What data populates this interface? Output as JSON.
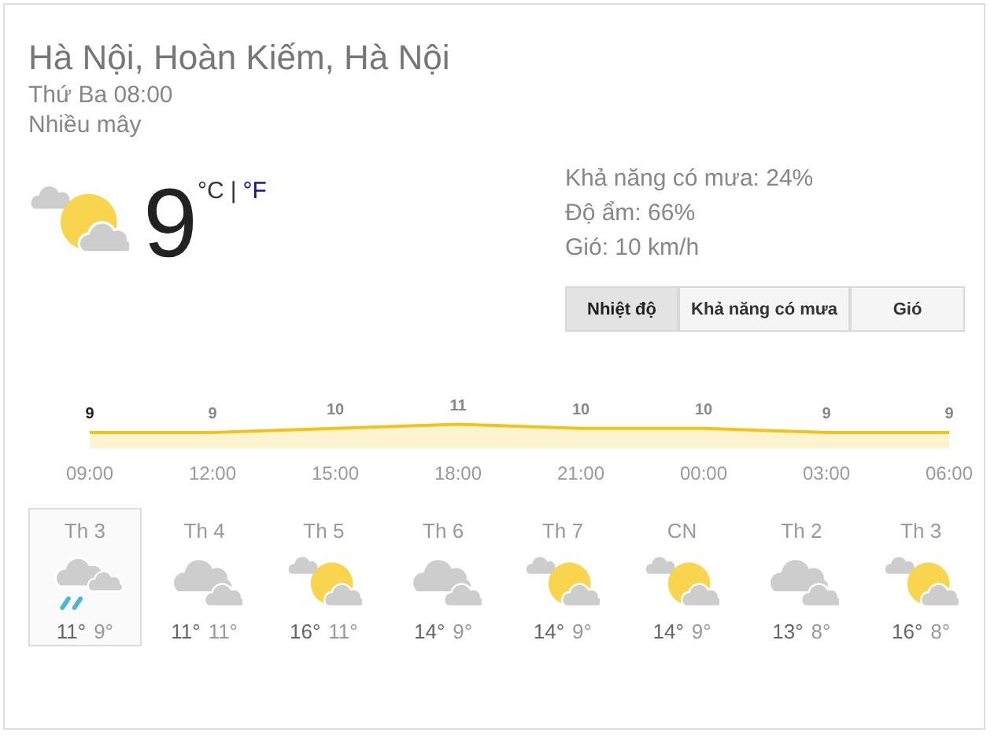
{
  "location": "Hà Nội, Hoàn Kiếm, Hà Nội",
  "time": "Thứ Ba 08:00",
  "condition": "Nhiều mây",
  "current": {
    "kind": "partly-cloudy",
    "temperature": "9",
    "units": [
      {
        "label": "°C",
        "selected": true
      },
      {
        "label": "°F",
        "selected": false
      }
    ],
    "separator": "|"
  },
  "details": [
    "Khả năng có mưa: 24%",
    "Độ ẩm: 66%",
    "Gió: 10 km/h"
  ],
  "tabs": [
    {
      "label": "Nhiệt độ",
      "selected": true
    },
    {
      "label": "Khả năng có mưa",
      "selected": false
    },
    {
      "label": "Gió",
      "selected": false
    }
  ],
  "chart_data": {
    "type": "area",
    "categories": [
      "09:00",
      "12:00",
      "15:00",
      "18:00",
      "21:00",
      "00:00",
      "03:00",
      "06:00"
    ],
    "series": [
      {
        "color": "#f2c418",
        "values": [
          9,
          9,
          10,
          11,
          10,
          10,
          9,
          9
        ]
      }
    ],
    "data_labels": true
  },
  "days": [
    {
      "day": "Th 3",
      "kind": "rain",
      "high": "11°",
      "low": "9°",
      "selected": true
    },
    {
      "day": "Th 4",
      "kind": "cloudy",
      "high": "11°",
      "low": "11°",
      "selected": false
    },
    {
      "day": "Th 5",
      "kind": "partly-cloudy",
      "high": "16°",
      "low": "11°",
      "selected": false
    },
    {
      "day": "Th 6",
      "kind": "cloudy",
      "high": "14°",
      "low": "9°",
      "selected": false
    },
    {
      "day": "Th 7",
      "kind": "partly-cloudy",
      "high": "14°",
      "low": "9°",
      "selected": false
    },
    {
      "day": "CN",
      "kind": "partly-cloudy",
      "high": "14°",
      "low": "9°",
      "selected": false
    },
    {
      "day": "Th 2",
      "kind": "cloudy",
      "high": "13°",
      "low": "8°",
      "selected": false
    },
    {
      "day": "Th 3",
      "kind": "partly-cloudy",
      "high": "16°",
      "low": "8°",
      "selected": false
    }
  ]
}
